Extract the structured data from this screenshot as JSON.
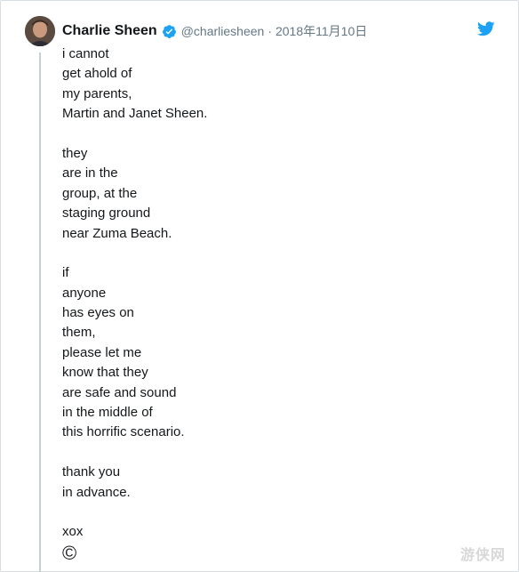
{
  "tweet": {
    "display_name": "Charlie Sheen",
    "handle": "@charliesheen",
    "separator": "·",
    "date": "2018年11月10日",
    "verified_icon": "verified-badge-icon",
    "brand_icon": "twitter-bird-icon",
    "brand_color": "#1da1f2",
    "body_lines": [
      "i cannot",
      "get ahold of",
      "my parents,",
      "Martin and Janet Sheen.",
      "",
      "they",
      "are in the",
      "group, at the",
      "staging ground",
      "near Zuma Beach.",
      "",
      "if",
      "anyone",
      "has eyes on",
      "them,",
      "please let me",
      "know that they",
      "are safe and sound",
      "in the middle of",
      "this horrific scenario.",
      "",
      "thank you",
      "in advance.",
      "",
      "xox",
      "©"
    ]
  },
  "watermark": {
    "text": "游侠网"
  }
}
